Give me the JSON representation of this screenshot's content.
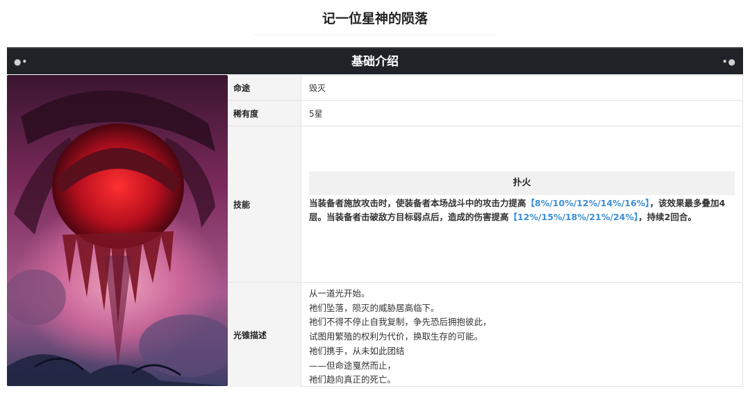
{
  "page": {
    "title": "记一位星神的陨落"
  },
  "section": {
    "title": "基础介绍"
  },
  "table": {
    "path_label": "命途",
    "path_value": "毁灭",
    "rarity_label": "稀有度",
    "rarity_value": "5星",
    "skill_label": "技能",
    "skill_name": "扑火",
    "skill_text_1": "当装备者施放攻击时，使装备者本场战斗中的攻击力提高",
    "skill_hl_1": "【8%/10%/12%/14%/16%】",
    "skill_text_2": "，该效果最多叠加4层。当装备者击破敌方目标弱点后，造成的伤害提高",
    "skill_hl_2": "【12%/15%/18%/21%/24%】",
    "skill_text_3": "，持续2回合。",
    "desc_label": "光锥描述",
    "desc_lines": [
      "从一道光开始。",
      "祂们坠落，陨灭的威胁居高临下。",
      "祂们不得不停止自我复制，争先恐后拥抱彼此，",
      "试图用繁殖的权利为代价，换取生存的可能。",
      "祂们携手，从未如此团结",
      "——但命途戛然而止，",
      "祂们趋向真正的死亡。"
    ]
  },
  "colors": {
    "header_bg": "#1f2226",
    "highlight": "#3d8fd6",
    "label_bg": "#f4f4f4"
  }
}
